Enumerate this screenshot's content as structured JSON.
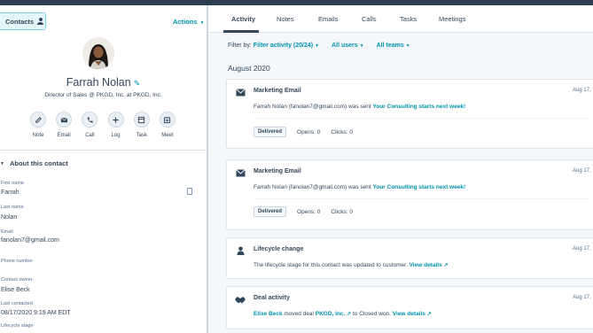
{
  "sidebar": {
    "breadcrumb": "Contacts",
    "actions_label": "Actions",
    "contact_name": "Farrah Nolan",
    "contact_title": "Director of Sales @ PKGD, Inc. at PKGD, Inc.",
    "action_buttons": [
      {
        "label": "Note",
        "icon": "note-icon"
      },
      {
        "label": "Email",
        "icon": "email-icon"
      },
      {
        "label": "Call",
        "icon": "phone-icon"
      },
      {
        "label": "Log",
        "icon": "plus-icon"
      },
      {
        "label": "Task",
        "icon": "task-icon"
      },
      {
        "label": "Meet",
        "icon": "calendar-icon"
      }
    ],
    "section_title": "About this contact",
    "fields": [
      {
        "label": "First name",
        "value": "Farrah"
      },
      {
        "label": "Last name",
        "value": "Nolan"
      },
      {
        "label": "Email",
        "value": "fanolan7@gmail.com"
      },
      {
        "label": "Phone number",
        "value": ""
      },
      {
        "label": "Contact owner",
        "value": "Elise Beck"
      },
      {
        "label": "Last contacted",
        "value": "08/17/2020 9:19 AM EDT"
      },
      {
        "label": "Lifecycle stage",
        "value": ""
      }
    ]
  },
  "main": {
    "tabs": [
      "Activity",
      "Notes",
      "Emails",
      "Calls",
      "Tasks",
      "Meetings"
    ],
    "active_tab": "Activity",
    "filter": {
      "label": "Filter by:",
      "activity": "Filter activity (20/24)",
      "users": "All users",
      "teams": "All teams"
    },
    "month": "August 2020",
    "cards": [
      {
        "type": "Marketing Email",
        "date": "Aug 17,",
        "text_prefix": "Farrah Nolan (fanolan7@gmail.com) was sent ",
        "link": "Your Consulting starts next week!",
        "status": "Delivered",
        "opens": "Opens: 0",
        "clicks": "Clicks: 0"
      },
      {
        "type": "Marketing Email",
        "date": "Aug 17,",
        "text_prefix": "Farrah Nolan (fanolan7@gmail.com) was sent ",
        "link": "Your Consulting starts next week!",
        "status": "Delivered",
        "opens": "Opens: 0",
        "clicks": "Clicks: 0"
      },
      {
        "type": "Lifecycle change",
        "date": "Aug 17,",
        "text_prefix": "The lifecycle stage for this contact was updated to customer. ",
        "link": "View details"
      },
      {
        "type": "Deal activity",
        "date": "Aug 17,",
        "actor": "Elise Beck",
        "moved": " moved deal ",
        "deal": "PKGD, Inc.",
        "stage": " to Closed won. ",
        "link": "View details"
      }
    ]
  },
  "colors": {
    "accent": "#0091ae",
    "text": "#33475b",
    "topbar": "#2d3e50",
    "background": "#f5f8fa"
  }
}
